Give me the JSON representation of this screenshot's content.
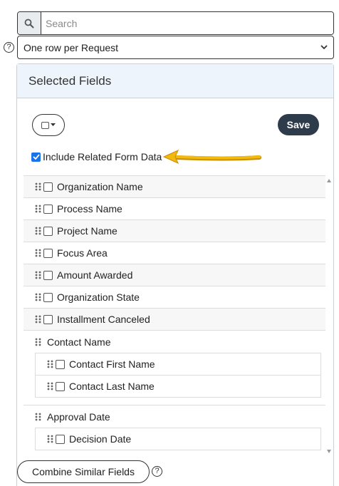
{
  "search": {
    "placeholder": "Search"
  },
  "row_mode": {
    "selected": "One row per Request"
  },
  "panel": {
    "title": "Selected Fields",
    "save_label": "Save",
    "include_label": "Include Related Form Data",
    "include_checked": true
  },
  "fields": [
    "Organization Name",
    "Process Name",
    "Project Name",
    "Focus Area",
    "Amount Awarded",
    "Organization State",
    "Installment Canceled"
  ],
  "groups": [
    {
      "name": "Contact Name",
      "children": [
        "Contact First Name",
        "Contact Last Name"
      ]
    },
    {
      "name": "Approval Date",
      "children": [
        "Decision Date"
      ]
    }
  ],
  "combine_label": "Combine Similar Fields",
  "colors": {
    "save_bg": "#2e3b4a",
    "header_bg": "#eef4fb",
    "arrow": "#f2b90f",
    "checkbox": "#1a73e8"
  }
}
